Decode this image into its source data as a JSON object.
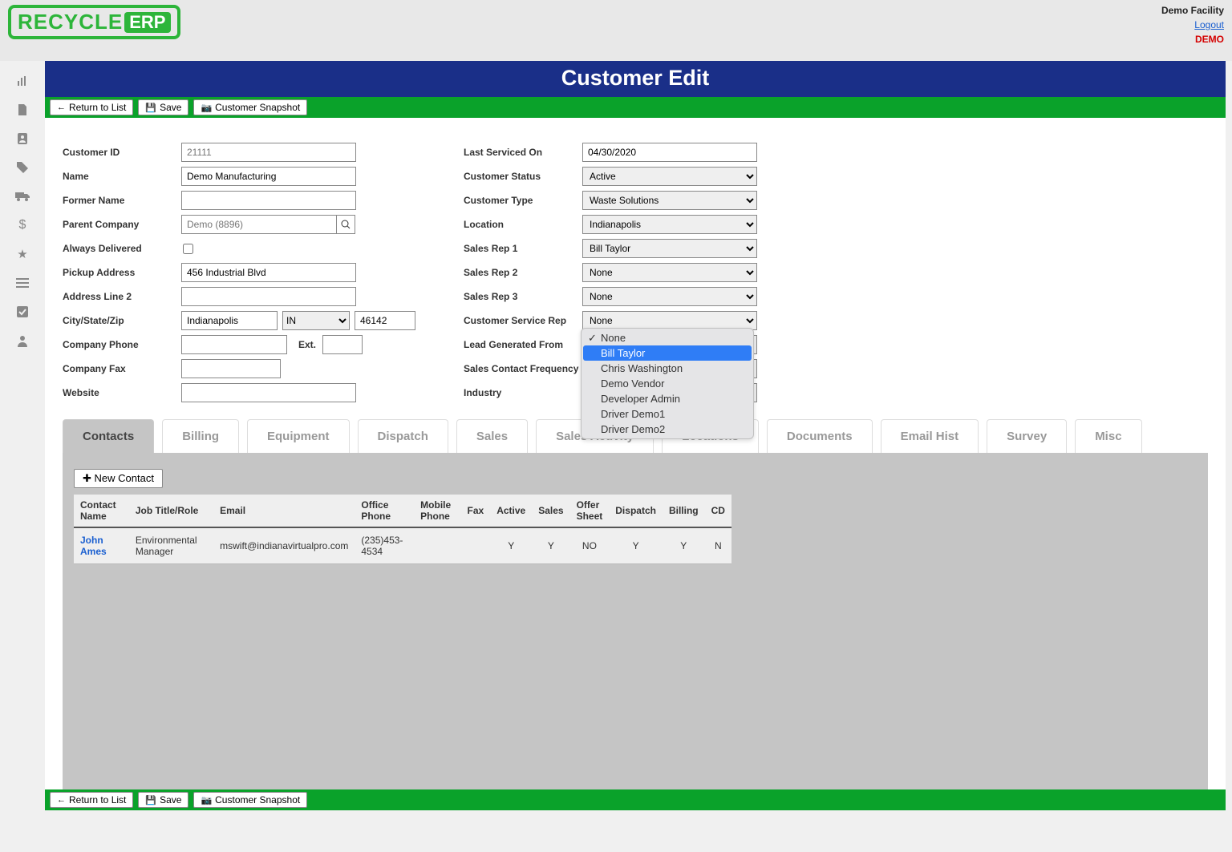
{
  "header": {
    "facility": "Demo Facility",
    "logout": "Logout",
    "demo": "DEMO",
    "logo_text1": "RECYCLE",
    "logo_text2": "ERP"
  },
  "page_title": "Customer Edit",
  "actions": {
    "return": "Return to List",
    "save": "Save",
    "snapshot": "Customer Snapshot"
  },
  "left_form": {
    "customer_id": {
      "label": "Customer ID",
      "value": "21111"
    },
    "name": {
      "label": "Name",
      "value": "Demo Manufacturing"
    },
    "former_name": {
      "label": "Former Name",
      "value": ""
    },
    "parent_company": {
      "label": "Parent Company",
      "placeholder": "Demo (8896)",
      "value": ""
    },
    "always_delivered": {
      "label": "Always Delivered"
    },
    "pickup_address": {
      "label": "Pickup Address",
      "value": "456 Industrial Blvd"
    },
    "address2": {
      "label": "Address Line 2",
      "value": ""
    },
    "city_state_zip": {
      "label": "City/State/Zip",
      "city": "Indianapolis",
      "state": "IN",
      "zip": "46142"
    },
    "company_phone": {
      "label": "Company Phone",
      "value": "",
      "ext_label": "Ext.",
      "ext": ""
    },
    "company_fax": {
      "label": "Company Fax",
      "value": ""
    },
    "website": {
      "label": "Website",
      "value": ""
    }
  },
  "right_form": {
    "last_serviced": {
      "label": "Last Serviced On",
      "value": "04/30/2020"
    },
    "customer_status": {
      "label": "Customer Status",
      "value": "Active"
    },
    "customer_type": {
      "label": "Customer Type",
      "value": "Waste Solutions"
    },
    "location": {
      "label": "Location",
      "value": "Indianapolis"
    },
    "sales_rep_1": {
      "label": "Sales Rep 1",
      "value": "Bill Taylor"
    },
    "sales_rep_2": {
      "label": "Sales Rep 2",
      "value": "None"
    },
    "sales_rep_3": {
      "label": "Sales Rep 3",
      "value": "None"
    },
    "csr": {
      "label": "Customer Service Rep",
      "value": "None"
    },
    "lead": {
      "label": "Lead Generated From",
      "value": ""
    },
    "frequency": {
      "label": "Sales Contact Frequency",
      "value": ""
    },
    "industry": {
      "label": "Industry",
      "value": ""
    }
  },
  "csr_dropdown": [
    "None",
    "Bill Taylor",
    "Chris Washington",
    "Demo Vendor",
    "Developer Admin",
    "Driver Demo1",
    "Driver Demo2"
  ],
  "tabs": [
    "Contacts",
    "Billing",
    "Equipment",
    "Dispatch",
    "Sales",
    "Sales Activity",
    "Locations",
    "Documents",
    "Email Hist",
    "Survey",
    "Misc"
  ],
  "contacts": {
    "new_btn": "New Contact",
    "columns": [
      "Contact Name",
      "Job Title/Role",
      "Email",
      "Office Phone",
      "Mobile Phone",
      "Fax",
      "Active",
      "Sales",
      "Offer Sheet",
      "Dispatch",
      "Billing",
      "CD"
    ],
    "rows": [
      {
        "name": "John Ames",
        "role": "Environmental Manager",
        "email": "mswift@indianavirtualpro.com",
        "office": "(235)453-4534",
        "mobile": "",
        "fax": "",
        "active": "Y",
        "sales": "Y",
        "offer": "NO",
        "dispatch": "Y",
        "billing": "Y",
        "cd": "N"
      }
    ]
  }
}
